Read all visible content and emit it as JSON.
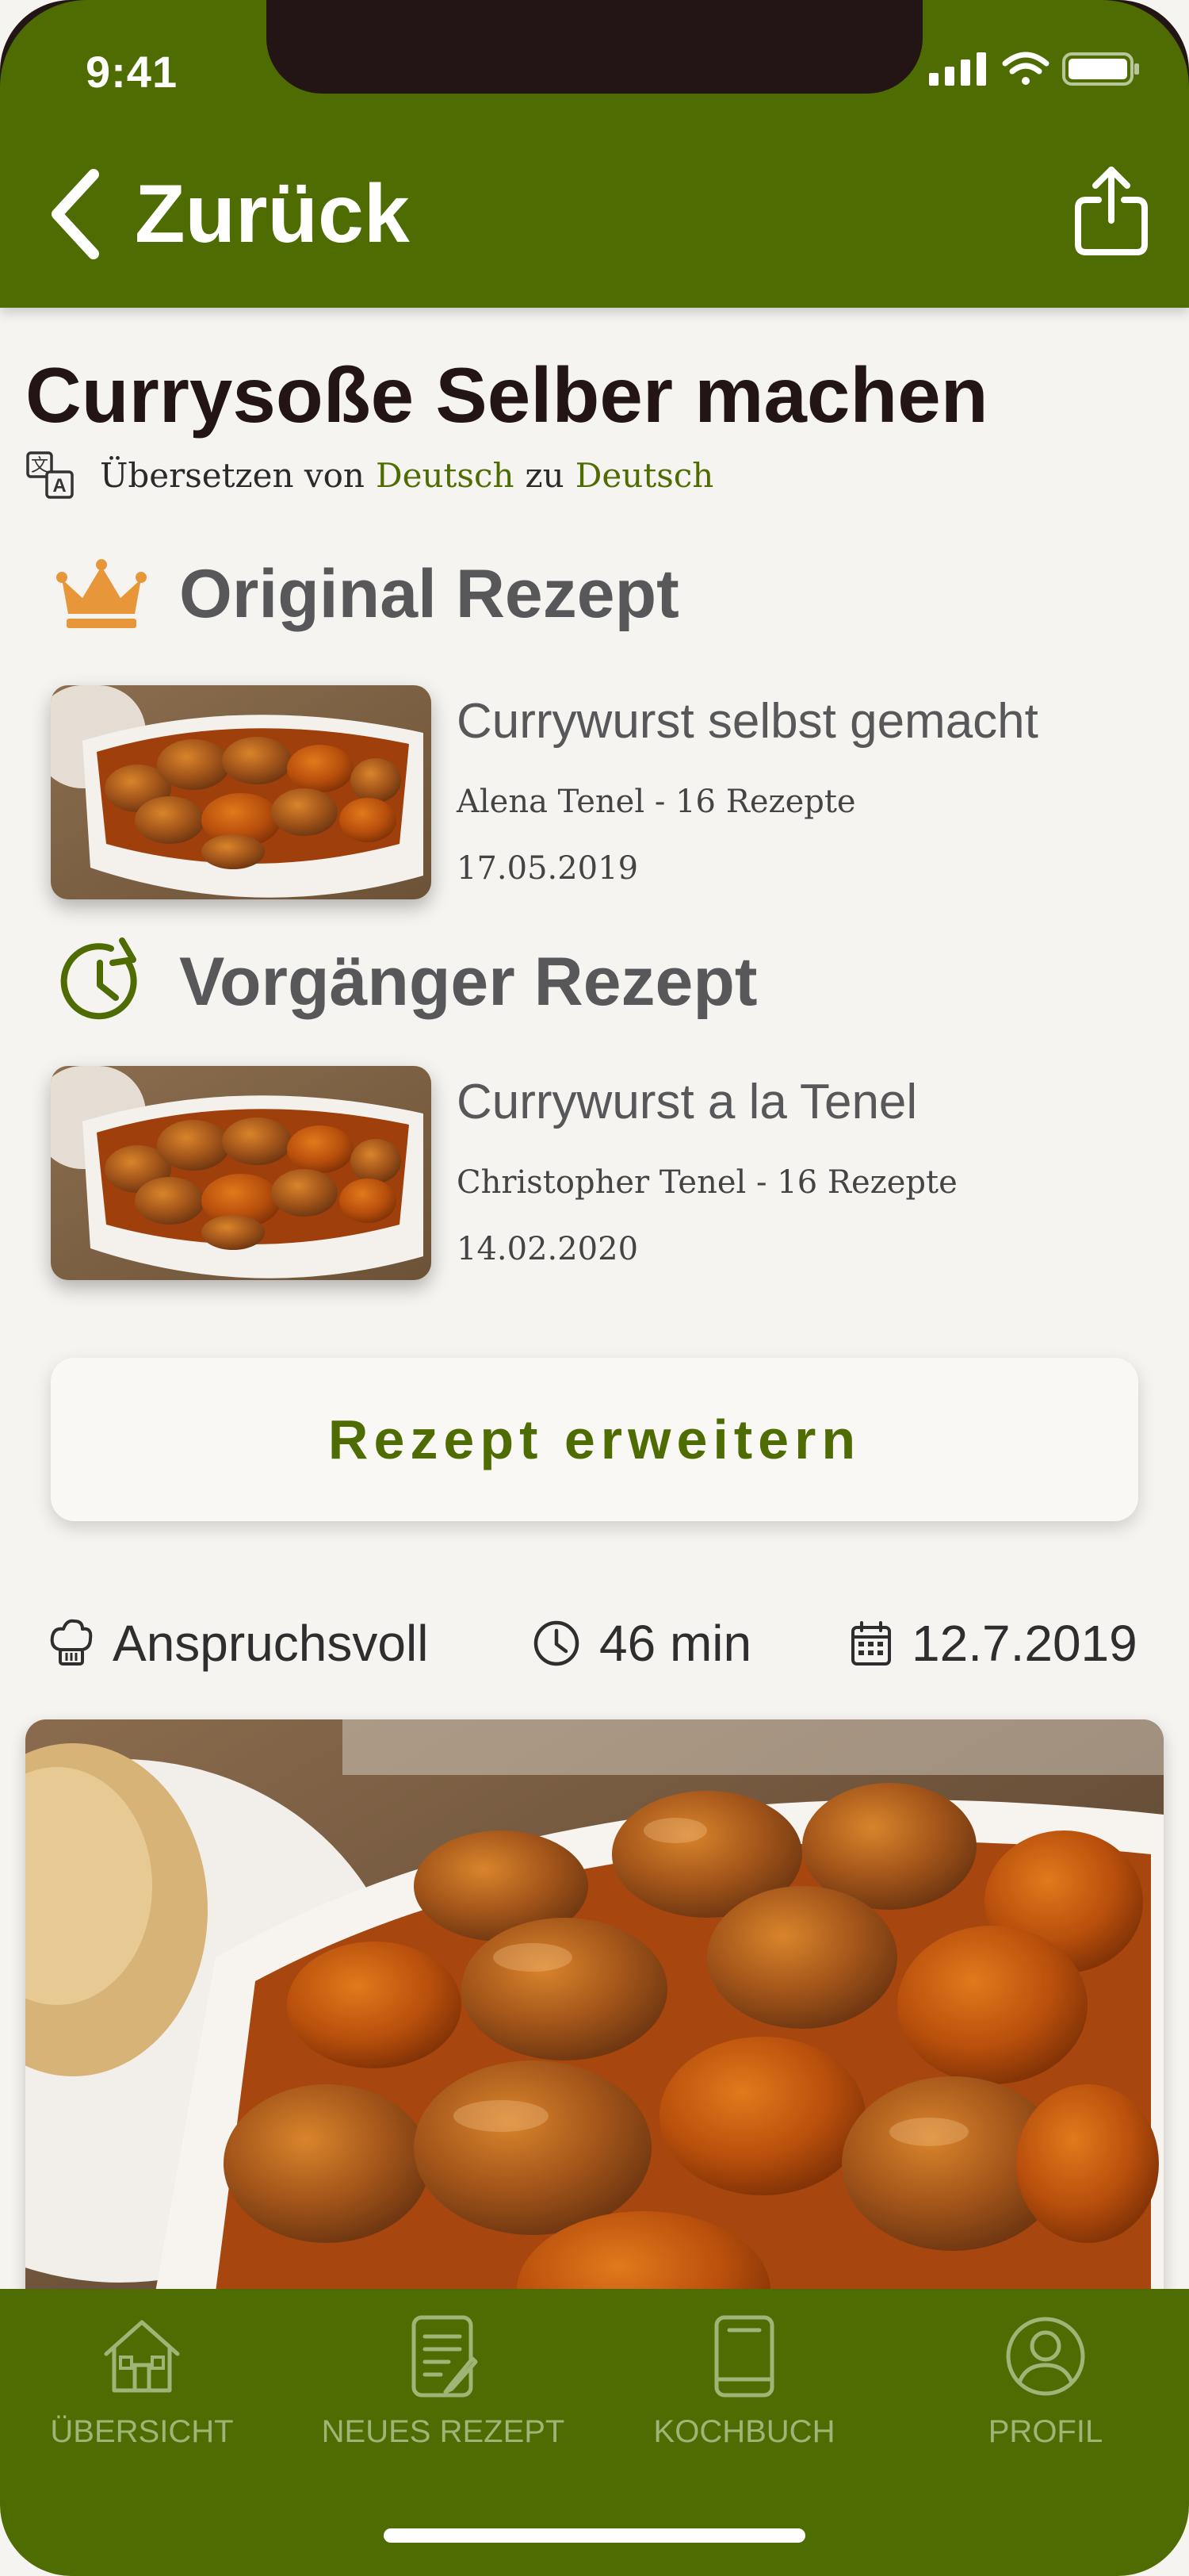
{
  "status_bar": {
    "time": "9:41"
  },
  "nav": {
    "back_label": "Zurück"
  },
  "recipe": {
    "title": "Currysoße Selber machen",
    "translate": {
      "prefix": "Übersetzen von",
      "from": "Deutsch",
      "middle": "zu",
      "to": "Deutsch"
    }
  },
  "original": {
    "heading": "Original Rezept",
    "item": {
      "title": "Currywurst selbst gemacht",
      "author": "Alena Tenel - 16 Rezepte",
      "date": "17.05.2019"
    }
  },
  "predecessor": {
    "heading": "Vorgänger Rezept",
    "item": {
      "title": "Currywurst a la Tenel",
      "author": "Christopher Tenel - 16 Rezepte",
      "date": "14.02.2020"
    }
  },
  "extend_button": {
    "label": "Rezept erweitern"
  },
  "meta": {
    "difficulty": "Anspruchsvoll",
    "duration": "46 min",
    "date": "12.7.2019"
  },
  "tabs": [
    {
      "label": "ÜBERSICHT",
      "icon": "home-icon"
    },
    {
      "label": "NEUES REZEPT",
      "icon": "new-recipe-icon"
    },
    {
      "label": "KOCHBUCH",
      "icon": "cookbook-icon"
    },
    {
      "label": "PROFIL",
      "icon": "profile-icon"
    }
  ],
  "colors": {
    "brand_green": "#4e6c02",
    "crown_orange": "#e8963a",
    "background": "#f6f4f0",
    "tab_inactive": "#9fb577"
  }
}
